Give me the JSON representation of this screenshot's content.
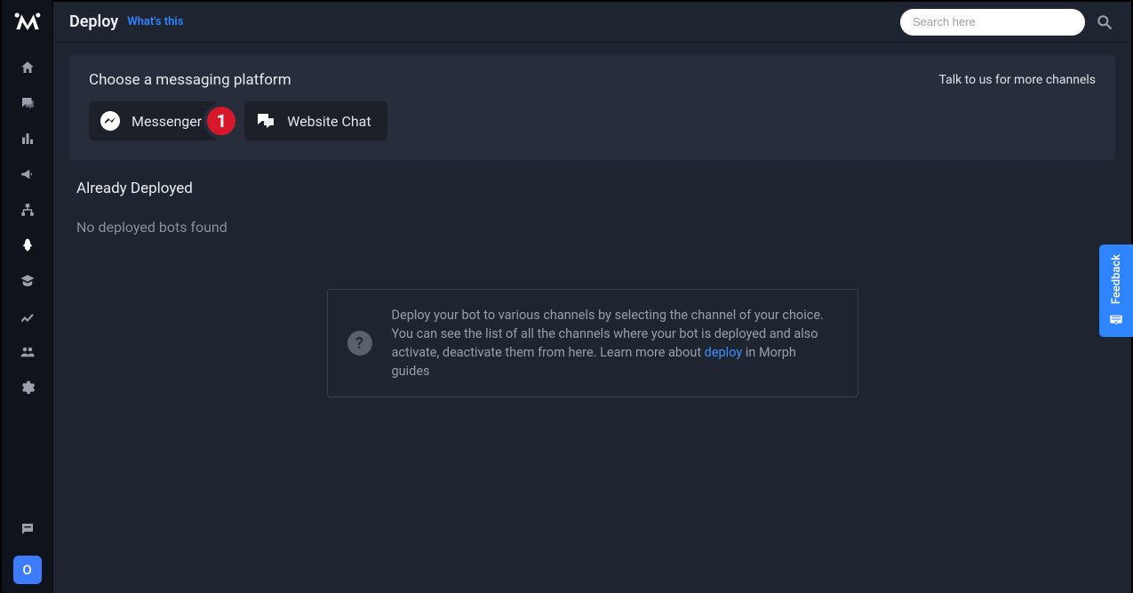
{
  "header": {
    "title": "Deploy",
    "whats_this": "What's this",
    "search_placeholder": "Search here"
  },
  "panel": {
    "title": "Choose a messaging platform",
    "talk_link": "Talk to us for more channels",
    "platforms": [
      {
        "label": "Messenger",
        "icon": "messenger-icon"
      },
      {
        "label": "Website Chat",
        "icon": "chat-bubbles-icon"
      }
    ],
    "badge_number": "1"
  },
  "deployed": {
    "title": "Already Deployed",
    "empty": "No deployed bots found"
  },
  "help": {
    "text_before": "Deploy your bot to various channels by selecting the channel of your choice. You can see the list of all the channels where your bot is deployed and also activate, deactivate them from here. Learn more about ",
    "link": "deploy",
    "text_after": " in Morph guides"
  },
  "feedback": {
    "label": "Feedback"
  },
  "avatar": {
    "initial": "O"
  },
  "sidebar": {
    "items": [
      "home",
      "conversations",
      "analytics",
      "broadcast",
      "flows",
      "deploy",
      "train",
      "growth",
      "users",
      "settings"
    ]
  }
}
